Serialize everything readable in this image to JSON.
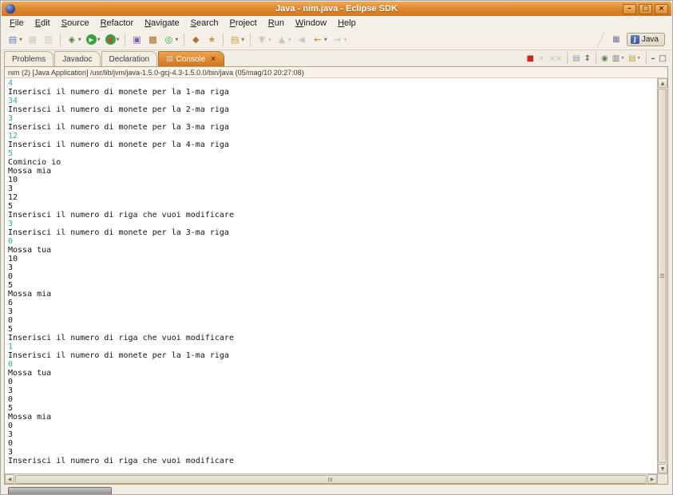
{
  "window": {
    "title": "Java - nim.java - Eclipse SDK",
    "controls": [
      {
        "name": "minimize-button",
        "glyph": "–"
      },
      {
        "name": "restore-button",
        "glyph": "□"
      },
      {
        "name": "close-button",
        "glyph": "×"
      }
    ]
  },
  "menu": {
    "items": [
      {
        "name": "menu-file",
        "label": "File"
      },
      {
        "name": "menu-edit",
        "label": "Edit"
      },
      {
        "name": "menu-source",
        "label": "Source"
      },
      {
        "name": "menu-refactor",
        "label": "Refactor"
      },
      {
        "name": "menu-navigate",
        "label": "Navigate"
      },
      {
        "name": "menu-search",
        "label": "Search"
      },
      {
        "name": "menu-project",
        "label": "Project"
      },
      {
        "name": "menu-run",
        "label": "Run"
      },
      {
        "name": "menu-window",
        "label": "Window"
      },
      {
        "name": "menu-help",
        "label": "Help"
      }
    ]
  },
  "toolbar": {
    "items": [
      {
        "name": "new-wizard-button",
        "glyph": "▤",
        "fg": "#5b79c0",
        "dd": true
      },
      {
        "name": "save-button",
        "glyph": "▦",
        "fg": "#8a8a8a",
        "disabled": true
      },
      {
        "name": "print-button",
        "glyph": "▥",
        "fg": "#8a8a8a",
        "disabled": true
      },
      {
        "sep": true
      },
      {
        "name": "debug-button",
        "glyph": "◈",
        "fg": "#4e7d3d",
        "dd": true
      },
      {
        "name": "run-button",
        "glyph": "▶",
        "fg": "#ffffff",
        "bg": "#36a23f",
        "dd": true
      },
      {
        "name": "external-tools-button",
        "glyph": "■",
        "fg": "#cc4433",
        "bg": "#36a23f",
        "dd": true
      },
      {
        "sep": true
      },
      {
        "name": "new-java-project-button",
        "glyph": "▣",
        "fg": "#7a5fb5"
      },
      {
        "name": "new-java-package-button",
        "glyph": "▩",
        "fg": "#a06b28"
      },
      {
        "name": "new-java-class-button",
        "glyph": "◎",
        "fg": "#2f9c45",
        "dd": true
      },
      {
        "sep": true
      },
      {
        "name": "open-type-button",
        "glyph": "◆",
        "fg": "#b07030"
      },
      {
        "name": "java-search-button",
        "glyph": "★",
        "fg": "#c09a40"
      },
      {
        "sep": true
      },
      {
        "name": "open-element-button",
        "glyph": "▤",
        "fg": "#d0a040",
        "dd": true
      },
      {
        "sep": true
      },
      {
        "name": "next-annotation-button",
        "glyph": "▼",
        "fg": "#888888",
        "dd": true,
        "disabled": true
      },
      {
        "name": "previous-annotation-button",
        "glyph": "▲",
        "fg": "#888888",
        "dd": true,
        "disabled": true
      },
      {
        "name": "last-edit-location-button",
        "glyph": "◀",
        "fg": "#888888",
        "disabled": true
      },
      {
        "name": "back-button",
        "glyph": "←",
        "fg": "#c79a3d",
        "dd": true
      },
      {
        "name": "forward-button",
        "glyph": "→",
        "fg": "#888888",
        "dd": true,
        "disabled": true
      }
    ],
    "perspective": {
      "open_glyph": "▦",
      "java_icon_glyph": "J",
      "java_label": "Java"
    }
  },
  "tabs": {
    "items": [
      {
        "name": "tab-problems",
        "label": "Problems"
      },
      {
        "name": "tab-javadoc",
        "label": "Javadoc"
      },
      {
        "name": "tab-declaration",
        "label": "Declaration"
      },
      {
        "name": "tab-console",
        "label": "Console",
        "active": true,
        "icon": "▤",
        "close": "×"
      }
    ]
  },
  "console_toolbar": {
    "items": [
      {
        "name": "terminate-button",
        "glyph": "■",
        "fg": "#cc2a2a"
      },
      {
        "name": "remove-launch-button",
        "glyph": "×",
        "fg": "#999999",
        "disabled": true
      },
      {
        "name": "remove-all-terminated-button",
        "glyph": "××",
        "fg": "#999999",
        "disabled": true
      },
      {
        "sep": true
      },
      {
        "name": "clear-console-button",
        "glyph": "▤",
        "fg": "#8a97b8"
      },
      {
        "name": "scroll-lock-button",
        "glyph": "↕",
        "fg": "#666677"
      },
      {
        "sep": true
      },
      {
        "name": "pin-console-button",
        "glyph": "◉",
        "fg": "#5a8a4a"
      },
      {
        "name": "display-selected-console-button",
        "glyph": "▥",
        "fg": "#777788",
        "dd": true
      },
      {
        "name": "open-console-button",
        "glyph": "▤",
        "fg": "#c09a50",
        "dd": true
      },
      {
        "sep": true
      },
      {
        "name": "minimize-view-button",
        "glyph": "–",
        "fg": "#555555"
      },
      {
        "name": "maximize-view-button",
        "glyph": "□",
        "fg": "#555555"
      }
    ]
  },
  "console": {
    "header": "nim (2) [Java Application] /usr/lib/jvm/java-1.5.0-gcj-4.3-1.5.0.0/bin/java (05/mag/10 20:27:08)",
    "colors": {
      "stdin": "#2fae93",
      "stdout": "#141414",
      "background": "#ffffff"
    },
    "lines": [
      {
        "text": "4",
        "stream": "stdin"
      },
      {
        "text": "Inserisci il numero di monete per la 1-ma riga",
        "stream": "stdout"
      },
      {
        "text": "34",
        "stream": "stdin"
      },
      {
        "text": "Inserisci il numero di monete per la 2-ma riga",
        "stream": "stdout"
      },
      {
        "text": "3",
        "stream": "stdin"
      },
      {
        "text": "Inserisci il numero di monete per la 3-ma riga",
        "stream": "stdout"
      },
      {
        "text": "12",
        "stream": "stdin"
      },
      {
        "text": "Inserisci il numero di monete per la 4-ma riga",
        "stream": "stdout"
      },
      {
        "text": "5",
        "stream": "stdin"
      },
      {
        "text": "Comincio io",
        "stream": "stdout"
      },
      {
        "text": "Mossa mia",
        "stream": "stdout"
      },
      {
        "text": "10",
        "stream": "stdout"
      },
      {
        "text": "3",
        "stream": "stdout"
      },
      {
        "text": "12",
        "stream": "stdout"
      },
      {
        "text": "5",
        "stream": "stdout"
      },
      {
        "text": "Inserisci il numero di riga che vuoi modificare",
        "stream": "stdout"
      },
      {
        "text": "3",
        "stream": "stdin"
      },
      {
        "text": "Inserisci il numero di monete per la 3-ma riga",
        "stream": "stdout"
      },
      {
        "text": "0",
        "stream": "stdin"
      },
      {
        "text": "Mossa tua",
        "stream": "stdout"
      },
      {
        "text": "10",
        "stream": "stdout"
      },
      {
        "text": "3",
        "stream": "stdout"
      },
      {
        "text": "0",
        "stream": "stdout"
      },
      {
        "text": "5",
        "stream": "stdout"
      },
      {
        "text": "Mossa mia",
        "stream": "stdout"
      },
      {
        "text": "6",
        "stream": "stdout"
      },
      {
        "text": "3",
        "stream": "stdout"
      },
      {
        "text": "0",
        "stream": "stdout"
      },
      {
        "text": "5",
        "stream": "stdout"
      },
      {
        "text": "Inserisci il numero di riga che vuoi modificare",
        "stream": "stdout"
      },
      {
        "text": "1",
        "stream": "stdin"
      },
      {
        "text": "Inserisci il numero di monete per la 1-ma riga",
        "stream": "stdout"
      },
      {
        "text": "0",
        "stream": "stdin"
      },
      {
        "text": "Mossa tua",
        "stream": "stdout"
      },
      {
        "text": "0",
        "stream": "stdout"
      },
      {
        "text": "3",
        "stream": "stdout"
      },
      {
        "text": "0",
        "stream": "stdout"
      },
      {
        "text": "5",
        "stream": "stdout"
      },
      {
        "text": "Mossa mia",
        "stream": "stdout"
      },
      {
        "text": "0",
        "stream": "stdout"
      },
      {
        "text": "3",
        "stream": "stdout"
      },
      {
        "text": "0",
        "stream": "stdout"
      },
      {
        "text": "3",
        "stream": "stdout"
      },
      {
        "text": "Inserisci il numero di riga che vuoi modificare",
        "stream": "stdout"
      }
    ]
  },
  "scrollbar": {
    "up_glyph": "▲",
    "down_glyph": "▼",
    "left_glyph": "◀",
    "right_glyph": "▶"
  },
  "theme": {
    "titlebar_orange": "#e08a33",
    "active_tab_orange": "#d1761f",
    "panel_cream": "#f4f0e7"
  }
}
